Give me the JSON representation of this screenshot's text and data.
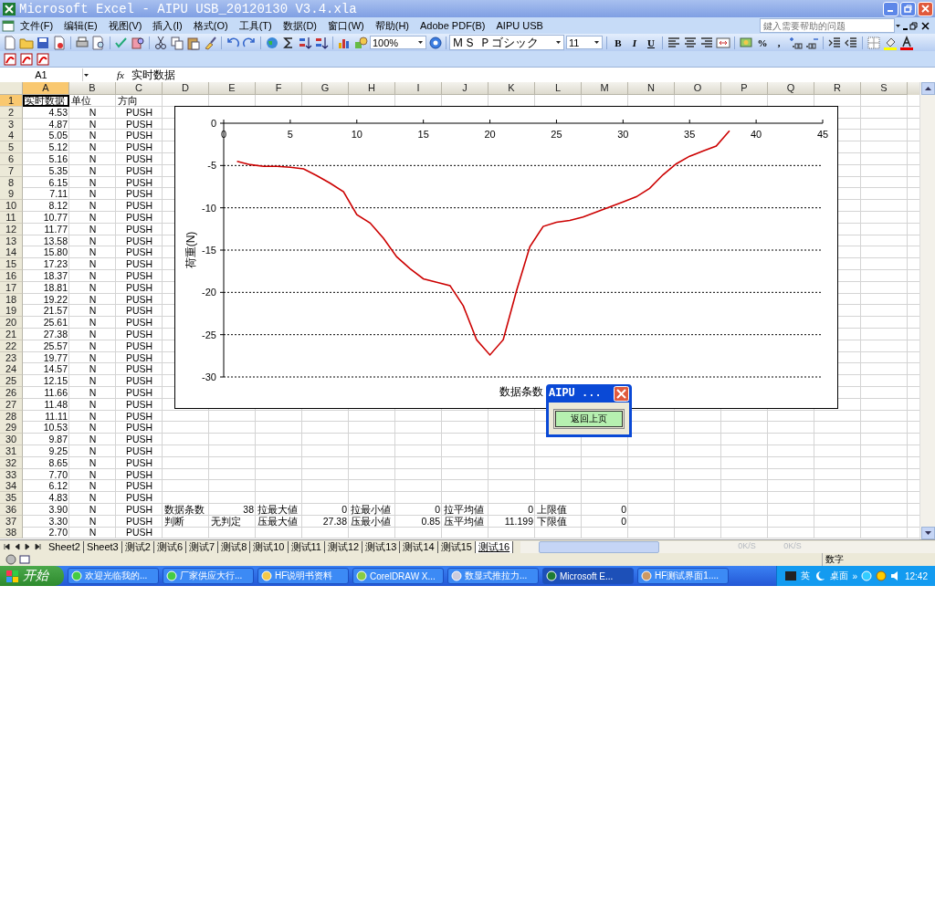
{
  "window": {
    "title": "Microsoft Excel - AIPU USB_20120130 V3.4.xla"
  },
  "menu": [
    "文件(F)",
    "编辑(E)",
    "视图(V)",
    "插入(I)",
    "格式(O)",
    "工具(T)",
    "数据(D)",
    "窗口(W)",
    "帮助(H)",
    "Adobe PDF(B)",
    "AIPU USB"
  ],
  "help_box": {
    "placeholder": "鍵入需要帮助的问题"
  },
  "toolbar": {
    "zoom": "100%",
    "font": "ＭＳ Ｐゴシック",
    "font_size": "11",
    "format_buttons": [
      "B",
      "I",
      "U"
    ],
    "number_buttons": [
      "%",
      ","
    ]
  },
  "formula_bar": {
    "name_box": "A1",
    "function_label": "fx",
    "value": "实时数据"
  },
  "columns": [
    {
      "label": "A",
      "selected": true
    },
    {
      "label": "B",
      "selected": false
    },
    {
      "label": "C",
      "selected": false
    },
    {
      "label": "D",
      "selected": false
    },
    {
      "label": "E",
      "selected": false
    },
    {
      "label": "F",
      "selected": false
    },
    {
      "label": "G",
      "selected": false
    },
    {
      "label": "H",
      "selected": false
    },
    {
      "label": "I",
      "selected": false
    },
    {
      "label": "J",
      "selected": false
    },
    {
      "label": "K",
      "selected": false
    },
    {
      "label": "L",
      "selected": false
    },
    {
      "label": "M",
      "selected": false
    },
    {
      "label": "N",
      "selected": false
    },
    {
      "label": "O",
      "selected": false
    },
    {
      "label": "P",
      "selected": false
    },
    {
      "label": "Q",
      "selected": false
    },
    {
      "label": "R",
      "selected": false
    },
    {
      "label": "S",
      "selected": false
    }
  ],
  "rows": [
    {
      "header": "1",
      "selected": true,
      "cells": [
        "实时数据",
        "单位",
        "方向"
      ]
    },
    {
      "header": "2",
      "selected": false,
      "cells": [
        "4.53",
        "N",
        "PUSH"
      ]
    },
    {
      "header": "3",
      "selected": false,
      "cells": [
        "4.87",
        "N",
        "PUSH"
      ]
    },
    {
      "header": "4",
      "selected": false,
      "cells": [
        "5.05",
        "N",
        "PUSH"
      ]
    },
    {
      "header": "5",
      "selected": false,
      "cells": [
        "5.12",
        "N",
        "PUSH"
      ]
    },
    {
      "header": "6",
      "selected": false,
      "cells": [
        "5.16",
        "N",
        "PUSH"
      ]
    },
    {
      "header": "7",
      "selected": false,
      "cells": [
        "5.35",
        "N",
        "PUSH"
      ]
    },
    {
      "header": "8",
      "selected": false,
      "cells": [
        "6.15",
        "N",
        "PUSH"
      ]
    },
    {
      "header": "9",
      "selected": false,
      "cells": [
        "7.11",
        "N",
        "PUSH"
      ]
    },
    {
      "header": "10",
      "selected": false,
      "cells": [
        "8.12",
        "N",
        "PUSH"
      ]
    },
    {
      "header": "11",
      "selected": false,
      "cells": [
        "10.77",
        "N",
        "PUSH"
      ]
    },
    {
      "header": "12",
      "selected": false,
      "cells": [
        "11.77",
        "N",
        "PUSH"
      ]
    },
    {
      "header": "13",
      "selected": false,
      "cells": [
        "13.58",
        "N",
        "PUSH"
      ]
    },
    {
      "header": "14",
      "selected": false,
      "cells": [
        "15.80",
        "N",
        "PUSH"
      ]
    },
    {
      "header": "15",
      "selected": false,
      "cells": [
        "17.23",
        "N",
        "PUSH"
      ]
    },
    {
      "header": "16",
      "selected": false,
      "cells": [
        "18.37",
        "N",
        "PUSH"
      ]
    },
    {
      "header": "17",
      "selected": false,
      "cells": [
        "18.81",
        "N",
        "PUSH"
      ]
    },
    {
      "header": "18",
      "selected": false,
      "cells": [
        "19.22",
        "N",
        "PUSH"
      ]
    },
    {
      "header": "19",
      "selected": false,
      "cells": [
        "21.57",
        "N",
        "PUSH"
      ]
    },
    {
      "header": "20",
      "selected": false,
      "cells": [
        "25.61",
        "N",
        "PUSH"
      ]
    },
    {
      "header": "21",
      "selected": false,
      "cells": [
        "27.38",
        "N",
        "PUSH"
      ]
    },
    {
      "header": "22",
      "selected": false,
      "cells": [
        "25.57",
        "N",
        "PUSH"
      ]
    },
    {
      "header": "23",
      "selected": false,
      "cells": [
        "19.77",
        "N",
        "PUSH"
      ]
    },
    {
      "header": "24",
      "selected": false,
      "cells": [
        "14.57",
        "N",
        "PUSH"
      ]
    },
    {
      "header": "25",
      "selected": false,
      "cells": [
        "12.15",
        "N",
        "PUSH"
      ]
    },
    {
      "header": "26",
      "selected": false,
      "cells": [
        "11.66",
        "N",
        "PUSH"
      ]
    },
    {
      "header": "27",
      "selected": false,
      "cells": [
        "11.48",
        "N",
        "PUSH"
      ]
    },
    {
      "header": "28",
      "selected": false,
      "cells": [
        "11.11",
        "N",
        "PUSH"
      ]
    },
    {
      "header": "29",
      "selected": false,
      "cells": [
        "10.53",
        "N",
        "PUSH"
      ]
    },
    {
      "header": "30",
      "selected": false,
      "cells": [
        "9.87",
        "N",
        "PUSH"
      ]
    },
    {
      "header": "31",
      "selected": false,
      "cells": [
        "9.25",
        "N",
        "PUSH"
      ]
    },
    {
      "header": "32",
      "selected": false,
      "cells": [
        "8.65",
        "N",
        "PUSH"
      ]
    },
    {
      "header": "33",
      "selected": false,
      "cells": [
        "7.70",
        "N",
        "PUSH"
      ]
    },
    {
      "header": "34",
      "selected": false,
      "cells": [
        "6.12",
        "N",
        "PUSH"
      ]
    },
    {
      "header": "35",
      "selected": false,
      "cells": [
        "4.83",
        "N",
        "PUSH"
      ]
    },
    {
      "header": "36",
      "selected": false,
      "cells": [
        "3.90",
        "N",
        "PUSH",
        "数据条数",
        "38",
        "拉最大値",
        "0",
        "拉最小値",
        "0",
        "拉平均値",
        "0",
        "上限值",
        "0"
      ]
    },
    {
      "header": "37",
      "selected": false,
      "cells": [
        "3.30",
        "N",
        "PUSH",
        "判断",
        "无判定",
        "压最大値",
        "27.38",
        "压最小値",
        "0.85",
        "压平均値",
        "11.199",
        "下限值",
        "0"
      ]
    },
    {
      "header": "38",
      "selected": false,
      "cells": [
        "2.70",
        "N",
        "PUSH"
      ]
    }
  ],
  "chart": {
    "chart_data": {
      "type": "line",
      "grid": true,
      "xlabel": "数据条数",
      "ylabel": "荷重(N)",
      "x": [
        1,
        2,
        3,
        4,
        5,
        6,
        7,
        8,
        9,
        10,
        11,
        12,
        13,
        14,
        15,
        16,
        17,
        18,
        19,
        20,
        21,
        22,
        23,
        24,
        25,
        26,
        27,
        28,
        29,
        30,
        31,
        32,
        33,
        34,
        35,
        36,
        37,
        38
      ],
      "series": [
        {
          "color": "#cc0000",
          "values": [
            -4.5,
            -4.9,
            -5.1,
            -5.1,
            -5.2,
            -5.4,
            -6.2,
            -7.1,
            -8.1,
            -10.8,
            -11.8,
            -13.6,
            -15.8,
            -17.2,
            -18.4,
            -18.8,
            -19.2,
            -21.6,
            -25.6,
            -27.4,
            -25.6,
            -19.8,
            -14.6,
            -12.2,
            -11.7,
            -11.5,
            -11.1,
            -10.5,
            -9.9,
            -9.3,
            -8.7,
            -7.7,
            -6.1,
            -4.8,
            -3.9,
            -3.3,
            -2.7,
            -0.9
          ]
        }
      ],
      "xlim": [
        0,
        45
      ],
      "ylim": [
        -30,
        0
      ],
      "xticks": [
        0,
        5,
        10,
        15,
        20,
        25,
        30,
        35,
        40,
        45
      ],
      "yticks": [
        0,
        -5,
        -10,
        -15,
        -20,
        -25,
        -30
      ]
    }
  },
  "dialog": {
    "title": "AIPU ...",
    "button": "返回上页"
  },
  "sheet_tabs": [
    {
      "label": "Sheet2",
      "selected": false
    },
    {
      "label": "Sheet3",
      "selected": false
    },
    {
      "label": "测试2",
      "selected": false
    },
    {
      "label": "测试6",
      "selected": false
    },
    {
      "label": "测试7",
      "selected": false
    },
    {
      "label": "测试8",
      "selected": false
    },
    {
      "label": "测试10",
      "selected": false
    },
    {
      "label": "测试11",
      "selected": false
    },
    {
      "label": "测试12",
      "selected": false
    },
    {
      "label": "测试13",
      "selected": false
    },
    {
      "label": "测试14",
      "selected": false
    },
    {
      "label": "测试15",
      "selected": false
    },
    {
      "label": "测试16",
      "selected": true
    }
  ],
  "net_speed": [
    "0K/S",
    "0K/S"
  ],
  "status_bar": {
    "mode": "数字"
  },
  "taskbar": {
    "start": "开始",
    "items": [
      {
        "label": "欢迎光临我的...",
        "selected": false
      },
      {
        "label": "厂家供应大行...",
        "selected": false
      },
      {
        "label": "HF说明书资料",
        "selected": false
      },
      {
        "label": "CorelDRAW X...",
        "selected": false
      },
      {
        "label": "数显式推拉力...",
        "selected": false
      },
      {
        "label": "Microsoft E...",
        "selected": true
      },
      {
        "label": "HF测试界面1....",
        "selected": false
      }
    ],
    "tray": {
      "ime": "英",
      "desktop": "桌面",
      "more": "»",
      "clock": "12:42"
    }
  }
}
